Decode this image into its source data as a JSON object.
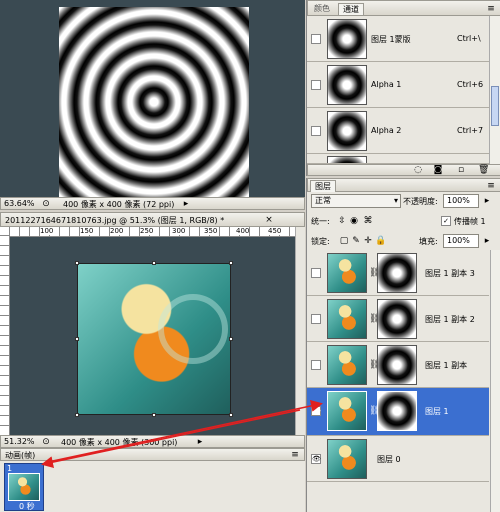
{
  "top_doc": {
    "zoom": "63.64%",
    "info": "400 像素 x 400 像素 (72 ppi)"
  },
  "channels_panel": {
    "tabs": [
      "颜色",
      "通道"
    ],
    "channels": [
      {
        "name": "图层 1蒙版",
        "shortcut": "Ctrl+\\"
      },
      {
        "name": "Alpha 1",
        "shortcut": "Ctrl+6"
      },
      {
        "name": "Alpha 2",
        "shortcut": "Ctrl+7"
      }
    ]
  },
  "main_doc": {
    "title": "20112271646718107​63.jpg @ 51.3% (图层 1, RGB/8) *",
    "ruler_labels": [
      "100",
      "150",
      "200",
      "250",
      "300",
      "350",
      "400",
      "450"
    ],
    "zoom": "51.32%",
    "info": "400 像素 x 400 像素 (300 ppi)"
  },
  "layers_panel": {
    "tab": "图层",
    "blend_mode": "正常",
    "opacity_label": "不透明度:",
    "opacity_value": "100%",
    "unify_label": "统一:",
    "propagate_label": "传播帧 1",
    "lock_label": "锁定:",
    "fill_label": "填充:",
    "fill_value": "100%",
    "layers": [
      {
        "name": "图层 1 副本 3",
        "selected": false,
        "visible": false
      },
      {
        "name": "图层 1 副本 2",
        "selected": false,
        "visible": false
      },
      {
        "name": "图层 1 副本",
        "selected": false,
        "visible": false
      },
      {
        "name": "图层 1",
        "selected": true,
        "visible": true
      },
      {
        "name": "图层 0",
        "selected": false,
        "visible": true
      }
    ]
  },
  "animation_panel": {
    "title": "动画(帧)",
    "frame_number": "1",
    "frame_delay": "0 秒"
  },
  "colors": {
    "selection": "#3b6fd0",
    "arrow": "#e02020"
  }
}
